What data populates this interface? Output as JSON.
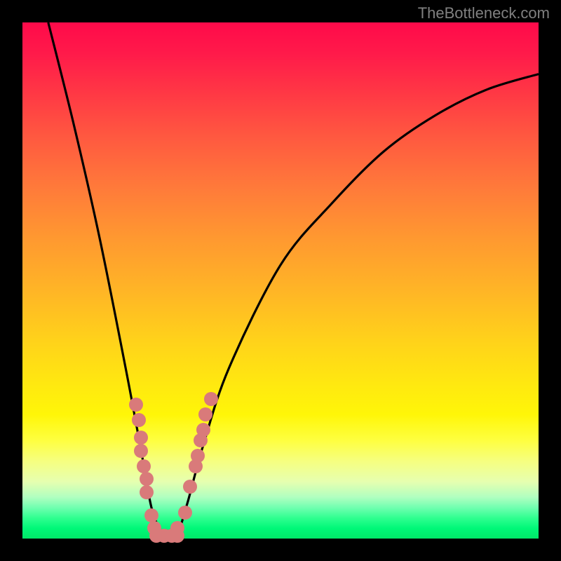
{
  "watermark": "TheBottleneck.com",
  "colors": {
    "marker": "#d97a7a",
    "curve": "#000000"
  },
  "chart_data": {
    "type": "line",
    "title": "",
    "xlabel": "",
    "ylabel": "",
    "xlim": [
      0,
      100
    ],
    "ylim": [
      0,
      100
    ],
    "series": [
      {
        "name": "bottleneck-curve",
        "description": "V-shaped bottleneck percentage curve, minimum near x≈28",
        "x": [
          5,
          10,
          15,
          20,
          23,
          25,
          27,
          28,
          30,
          32,
          35,
          40,
          50,
          60,
          70,
          80,
          90,
          100
        ],
        "y": [
          100,
          80,
          58,
          33,
          17,
          6,
          1,
          0,
          1,
          7,
          18,
          33,
          53,
          65,
          75,
          82,
          87,
          90
        ]
      }
    ],
    "markers": {
      "name": "sample-points",
      "description": "Salmon-colored data point markers clustered near the curve minimum",
      "points": [
        {
          "x": 22.0,
          "y": 26.0
        },
        {
          "x": 22.5,
          "y": 23.0
        },
        {
          "x": 23.0,
          "y": 19.5
        },
        {
          "x": 23.0,
          "y": 17.0
        },
        {
          "x": 23.5,
          "y": 14.0
        },
        {
          "x": 24.0,
          "y": 11.5
        },
        {
          "x": 24.0,
          "y": 9.0
        },
        {
          "x": 25.0,
          "y": 4.5
        },
        {
          "x": 25.5,
          "y": 2.0
        },
        {
          "x": 26.0,
          "y": 0.5
        },
        {
          "x": 27.5,
          "y": 0.5
        },
        {
          "x": 29.0,
          "y": 0.5
        },
        {
          "x": 30.0,
          "y": 0.5
        },
        {
          "x": 30.0,
          "y": 2.0
        },
        {
          "x": 31.5,
          "y": 5.0
        },
        {
          "x": 32.5,
          "y": 10.0
        },
        {
          "x": 33.5,
          "y": 14.0
        },
        {
          "x": 34.0,
          "y": 16.0
        },
        {
          "x": 34.5,
          "y": 19.0
        },
        {
          "x": 35.0,
          "y": 21.0
        },
        {
          "x": 35.5,
          "y": 24.0
        },
        {
          "x": 36.5,
          "y": 27.0
        }
      ]
    }
  }
}
